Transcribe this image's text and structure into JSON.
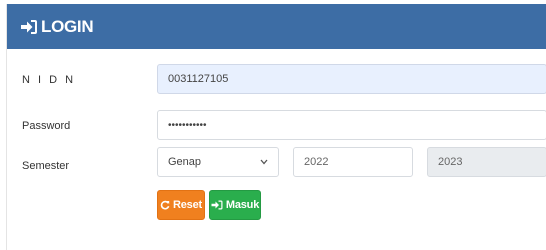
{
  "header": {
    "title": "LOGIN",
    "icon": "sign-in-icon",
    "background_color": "#3d6da5"
  },
  "form": {
    "nidn": {
      "label": "N I D N",
      "value": "0031127105"
    },
    "password": {
      "label": "Password",
      "value": "•••••••••••"
    },
    "semester": {
      "label": "Semester",
      "selected": "Genap",
      "year_start": "2022",
      "year_end": "2023"
    }
  },
  "buttons": {
    "reset": {
      "label": "Reset",
      "icon": "refresh-icon",
      "color": "#f0801f"
    },
    "masuk": {
      "label": "Masuk",
      "icon": "sign-in-icon",
      "color": "#2aae4d"
    }
  }
}
